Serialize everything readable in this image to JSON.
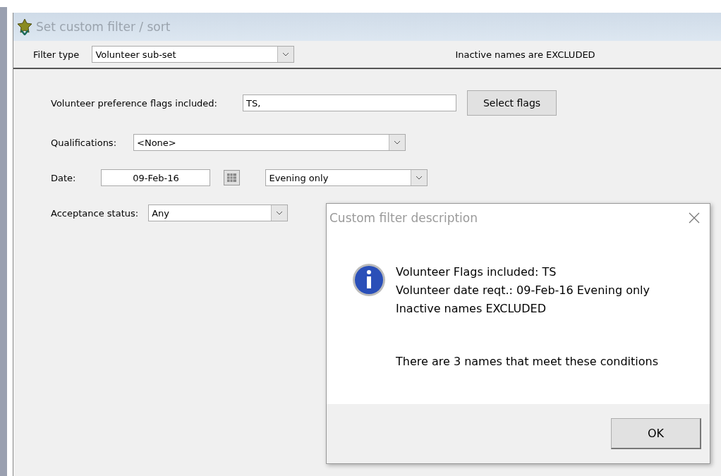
{
  "window": {
    "title": "Set custom filter / sort"
  },
  "filter_type": {
    "label": "Filter type",
    "value": "Volunteer sub-set"
  },
  "inactive_note": "Inactive names are EXCLUDED",
  "form": {
    "flags": {
      "label": "Volunteer preference flags included:",
      "value": "TS,",
      "button": "Select  flags"
    },
    "qualifications": {
      "label": "Qualifications:",
      "value": "<None>"
    },
    "date": {
      "label": "Date:",
      "value": "09-Feb-16",
      "period": "Evening only"
    },
    "acceptance": {
      "label": "Acceptance status:",
      "value": "Any"
    }
  },
  "dialog": {
    "title": "Custom filter description",
    "lines": [
      "Volunteer Flags included: TS",
      "Volunteer date reqt.: 09-Feb-16 Evening only",
      "Inactive names EXCLUDED"
    ],
    "summary": "There are 3 names that meet these conditions",
    "button": "OK"
  }
}
